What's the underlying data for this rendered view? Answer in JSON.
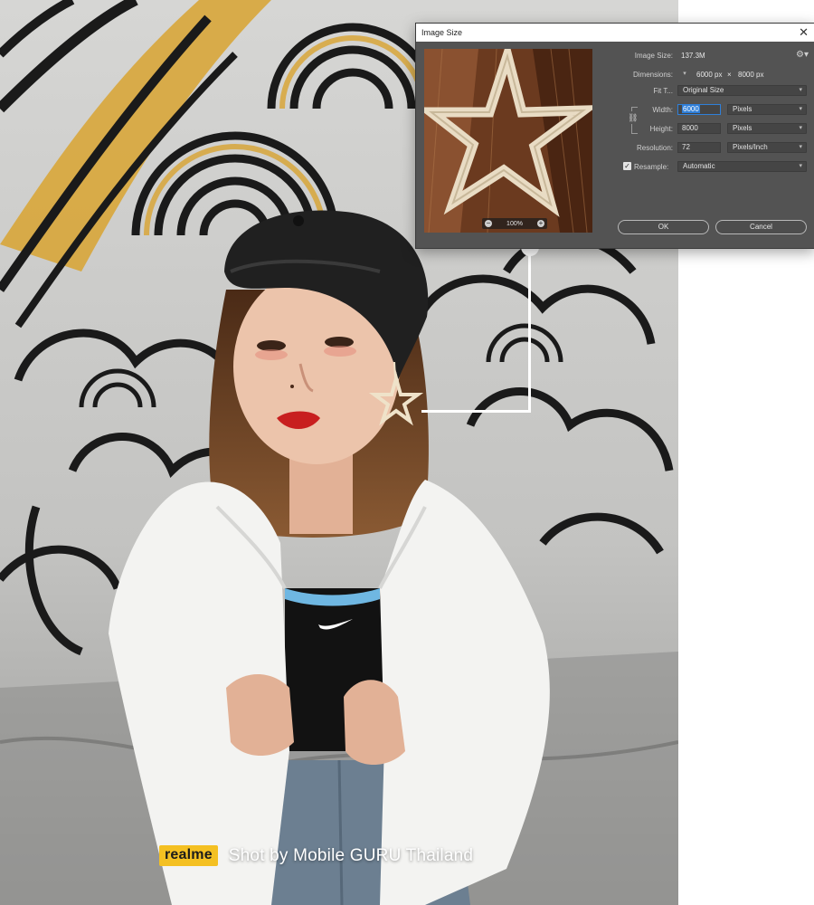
{
  "photo": {
    "alt_label": "Portrait photo",
    "brand_logo": "realme",
    "watermark": "Shot by Mobile GURU Thailand"
  },
  "dialog": {
    "title": "Image Size",
    "close_symbol": "✕",
    "preview": {
      "zoom_level": "100%",
      "zoom_out_symbol": "−",
      "zoom_in_symbol": "+"
    },
    "image_size_label": "Image Size:",
    "image_size_value": "137.3M",
    "dimensions_label": "Dimensions:",
    "dimensions_width": "6000 px",
    "dimensions_separator": "×",
    "dimensions_height": "8000 px",
    "fit_to_label": "Fit T...",
    "fit_to_value": "Original Size",
    "width_label": "Width:",
    "width_value": "6000",
    "width_unit": "Pixels",
    "height_label": "Height:",
    "height_value": "8000",
    "height_unit": "Pixels",
    "resolution_label": "Resolution:",
    "resolution_value": "72",
    "resolution_unit": "Pixels/Inch",
    "resample_label": "Resample:",
    "resample_checked": true,
    "resample_value": "Automatic",
    "ok_label": "OK",
    "cancel_label": "Cancel",
    "icons": {
      "gear": "gear-icon",
      "link": "link-icon",
      "chevron": "chevron-down-icon"
    }
  },
  "colors": {
    "dialog_bg": "#535353",
    "field_bg": "#454545",
    "focus_accent": "#2f7fd9",
    "realme_yellow": "#f4c022"
  }
}
